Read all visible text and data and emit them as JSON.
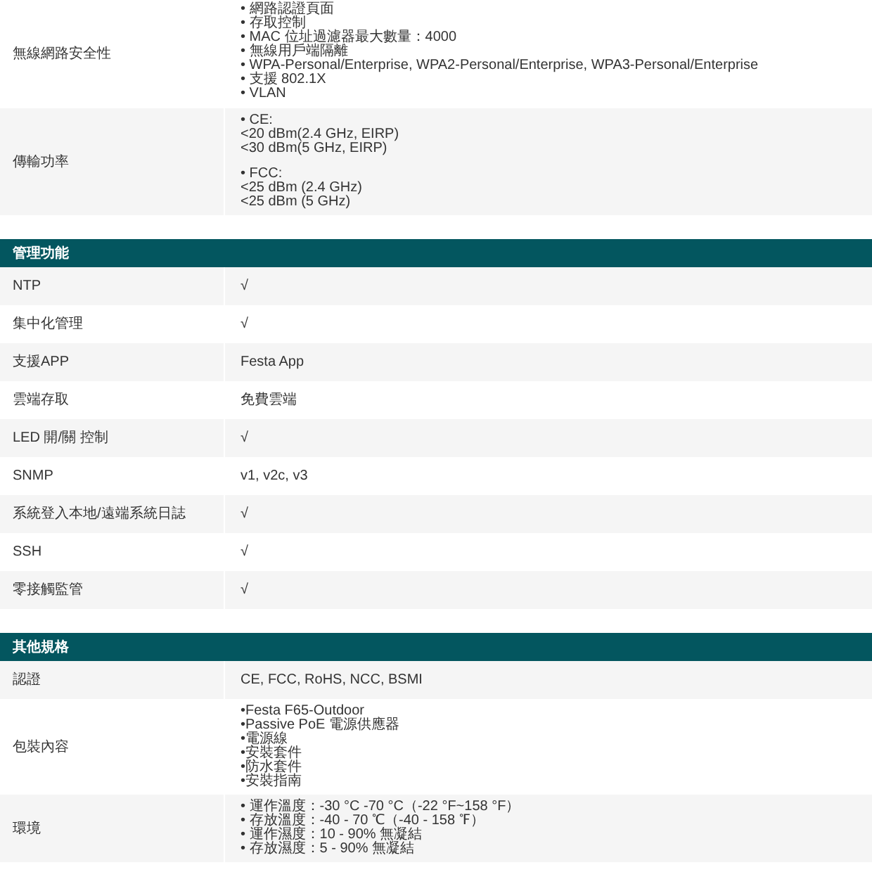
{
  "sections": [
    {
      "rows": [
        {
          "label": "無線網路安全性",
          "value": [
            [
              "• 網路認證頁面",
              "• 存取控制",
              "• MAC 位址過濾器最大數量：4000",
              "• 無線用戶端隔離",
              "• WPA-Personal/Enterprise, WPA2-Personal/Enterprise, WPA3-Personal/Enterprise",
              "• 支援 802.1X",
              "• VLAN"
            ]
          ]
        },
        {
          "label": "傳輸功率",
          "value": [
            [
              "• CE:",
              "<20 dBm(2.4 GHz, EIRP)",
              "<30 dBm(5 GHz, EIRP)"
            ],
            [
              "• FCC:",
              "<25 dBm (2.4 GHz)",
              "<25 dBm (5 GHz)"
            ]
          ]
        }
      ]
    },
    {
      "title": "管理功能",
      "rows": [
        {
          "label": "NTP",
          "value": [
            [
              "√"
            ]
          ]
        },
        {
          "label": "集中化管理",
          "value": [
            [
              "√"
            ]
          ]
        },
        {
          "label": "支援APP",
          "value": [
            [
              "Festa App"
            ]
          ]
        },
        {
          "label": "雲端存取",
          "value": [
            [
              "免費雲端"
            ]
          ]
        },
        {
          "label": "LED 開/關 控制",
          "value": [
            [
              "√"
            ]
          ]
        },
        {
          "label": "SNMP",
          "value": [
            [
              "v1, v2c, v3"
            ]
          ]
        },
        {
          "label": "系統登入本地/遠端系統日誌",
          "value": [
            [
              "√"
            ]
          ]
        },
        {
          "label": "SSH",
          "value": [
            [
              "√"
            ]
          ]
        },
        {
          "label": "零接觸監管",
          "value": [
            [
              "√"
            ]
          ]
        }
      ]
    },
    {
      "title": "其他規格",
      "rows": [
        {
          "label": "認證",
          "value": [
            [
              "CE, FCC, RoHS, NCC, BSMI"
            ]
          ]
        },
        {
          "label": "包裝內容",
          "value": [
            [
              "•Festa F65-Outdoor",
              "•Passive PoE 電源供應器",
              "•電源線",
              "•安裝套件",
              "•防水套件",
              "•安裝指南"
            ]
          ]
        },
        {
          "label": "環境",
          "value": [
            [
              "• 運作溫度：-30 °C -70 °C（-22 °F~158 °F）",
              "• 存放溫度：-40 - 70 ℃（-40 - 158 ℉）",
              "• 運作濕度：10 - 90% 無凝結",
              "• 存放濕度：5 - 90% 無凝結"
            ]
          ]
        }
      ]
    }
  ]
}
